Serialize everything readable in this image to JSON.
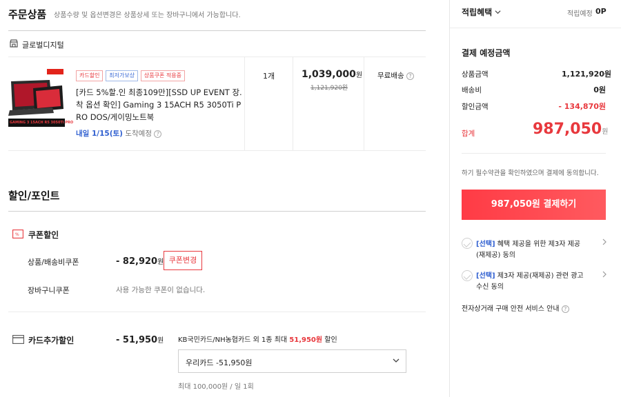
{
  "order": {
    "title": "주문상품",
    "notice": "상품수량 및 옵션변경은 상품상세 또는 장바구니에서 가능합니다.",
    "seller_icon": "store-icon",
    "seller": "글로벌디지털",
    "item": {
      "tags": [
        "카드할인",
        "최저가보상",
        "상품쿠폰 적용중"
      ],
      "name_line1": "[카드 5%할.인 최종109만][SSD UP EVENT 장.",
      "name_line2": "착 옵션 확인] Gaming 3 15ACH R5 3050Ti P",
      "name_line3": "RO DOS/게이밍노트북",
      "delivery_date": "내일 1/15(토)",
      "delivery_suffix": "도착예정",
      "quantity": "1개",
      "price": "1,039,000",
      "price_unit": "원",
      "original_price": "1,121,920원",
      "shipping": "무료배송",
      "thumb_caption": "GAMING 3 15ACH R5 3050Ti PRO"
    }
  },
  "discount": {
    "title": "할인/포인트",
    "coupon_title": "쿠폰할인",
    "product_coupon_label": "상품/배송비쿠폰",
    "product_coupon_value": "- 82,920",
    "product_coupon_unit": "원",
    "change_coupon_button": "쿠폰변경",
    "cart_coupon_label": "장바구니쿠폰",
    "cart_coupon_value": "사용 가능한 쿠폰이 없습니다.",
    "card_title": "카드추가할인",
    "card_value": "- 51,950",
    "card_unit": "원",
    "card_desc_prefix": "KB국민카드/NH농협카드 외 1종 최대",
    "card_desc_highlight": "51,950원",
    "card_desc_suffix": "할인",
    "card_select": "우리카드 -51,950원",
    "card_limit": "최대 100,000원 / 일 1회"
  },
  "summary": {
    "points_title": "적립혜택",
    "points_label": "적립예정",
    "points_value": "0P",
    "pay_title": "결제 예정금액",
    "rows": [
      {
        "label": "상품금액",
        "value": "1,121,920원"
      },
      {
        "label": "배송비",
        "value": "0원"
      },
      {
        "label": "할인금액",
        "value": "- 134,870원"
      }
    ],
    "total_label": "합계",
    "total_value": "987,050",
    "total_unit": "원",
    "agree_text": "하기 필수약관을 확인하였으며 결제에 동의합니다.",
    "pay_button": "987,050원 결제하기",
    "terms": [
      {
        "tag": "[선택]",
        "line1": "혜택 제공을 위한 제3자 제공",
        "line2": "(재제공) 동의"
      },
      {
        "tag": "[선택]",
        "line1": "제3자 제공(재제공) 관련 광고",
        "line2": "수신 동의"
      }
    ],
    "safety_text": "전자상거래 구매 안전 서비스 안내"
  },
  "colors": {
    "accent": "#e8383d",
    "link": "#2f5fd0"
  }
}
